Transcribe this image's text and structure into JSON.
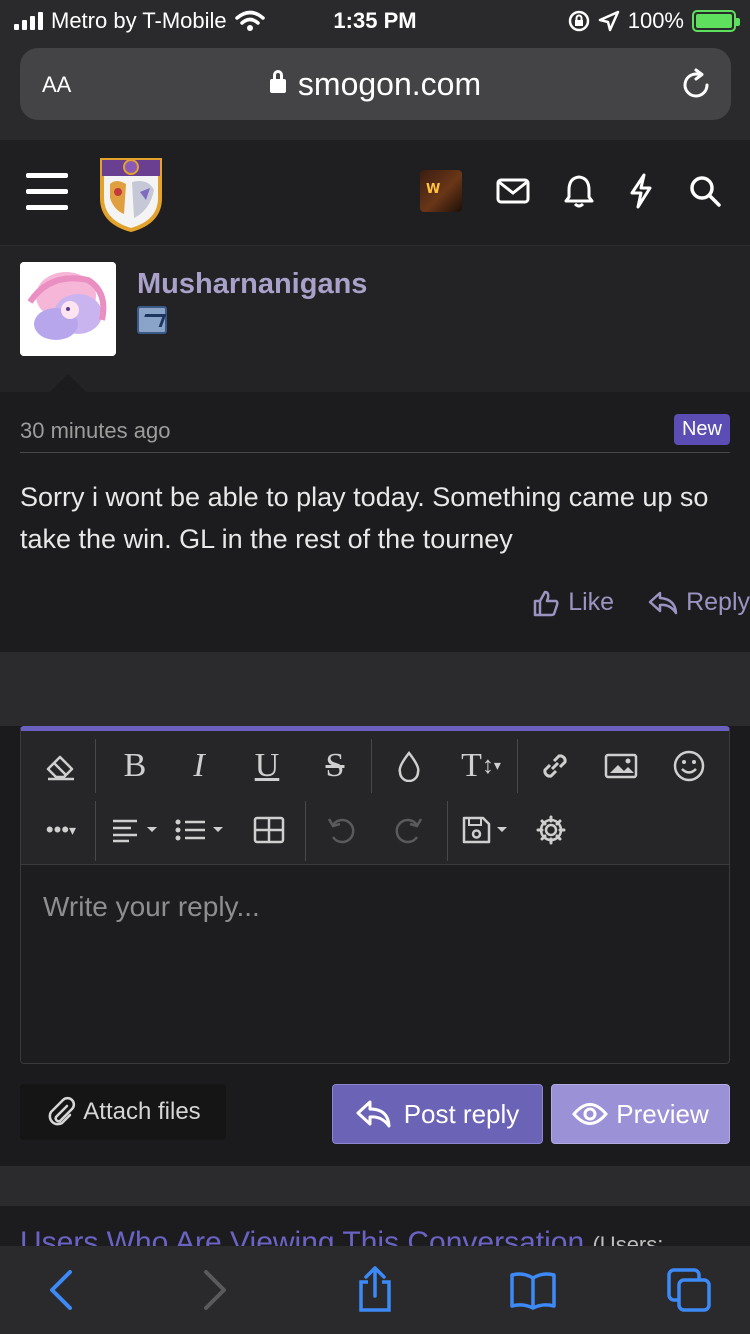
{
  "status_bar": {
    "carrier": "Metro by T-Mobile",
    "time": "1:35 PM",
    "battery": "100%"
  },
  "browser": {
    "text_size_label": "AA",
    "domain": "smogon.com"
  },
  "post": {
    "username": "Musharnanigans",
    "time": "30 minutes ago",
    "badge": "New",
    "text": "Sorry i wont be able to play today. Something came up so take the win. GL in the rest of the tourney",
    "like_label": "Like",
    "reply_label": "Reply"
  },
  "editor": {
    "placeholder": "Write your reply...",
    "toolbar": {
      "row1": [
        "eraser-icon",
        "bold-icon",
        "italic-icon",
        "underline-icon",
        "strikethrough-icon",
        "color-drop-icon",
        "font-size-icon",
        "link-icon",
        "image-icon",
        "smiley-icon"
      ],
      "row2": [
        "more-icon",
        "align-icon",
        "list-icon",
        "table-icon",
        "undo-icon",
        "redo-icon",
        "drafts-icon",
        "settings-icon"
      ]
    }
  },
  "actions": {
    "attach_label": "Attach files",
    "post_reply_label": "Post reply",
    "preview_label": "Preview"
  },
  "viewing": {
    "link_text": "Users Who Are Viewing This Conversation",
    "count_text": "(Users:"
  },
  "colors": {
    "accent": "#6b5fc0",
    "username": "#a9a1c9",
    "new_badge": "#5b4db3",
    "battery": "#5ee05e",
    "safari_blue": "#3d8af7"
  }
}
